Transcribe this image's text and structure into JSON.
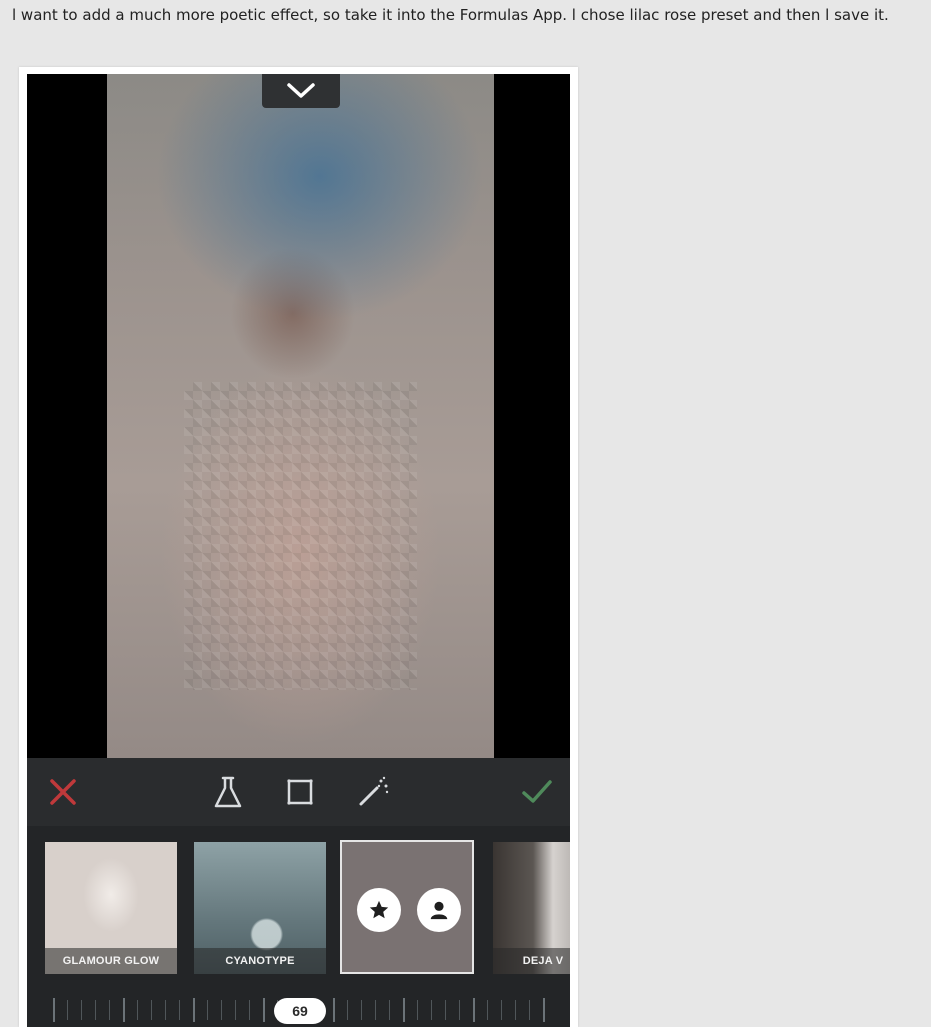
{
  "caption": "l want to add a much more poetic effect, so take it into the Formulas App. l chose lilac rose preset and then l save it.",
  "toolbar": {
    "cancel_icon": "close-icon",
    "formula_icon": "flask-icon",
    "frame_icon": "frame-icon",
    "magic_icon": "magic-wand-icon",
    "confirm_icon": "checkmark-icon"
  },
  "presets": [
    {
      "label": "GLAMOUR GLOW"
    },
    {
      "label": "CYANOTYPE"
    },
    {
      "label": "",
      "selected": true,
      "actions": [
        "star-icon",
        "person-icon"
      ]
    },
    {
      "label": "DEJA V"
    }
  ],
  "slider": {
    "value": "69"
  },
  "colors": {
    "cancel": "#c0393b",
    "confirm": "#4f8a5b",
    "tool": "#d9dcdf",
    "panel": "#2a2c2e",
    "background": "#e7e7e7"
  }
}
